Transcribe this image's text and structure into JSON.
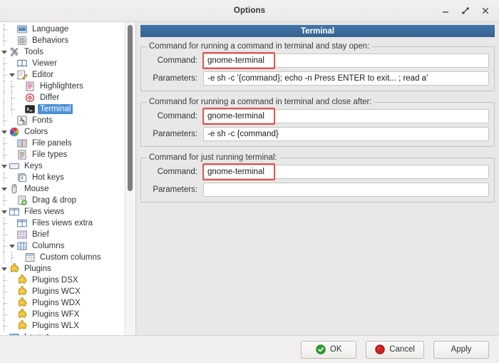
{
  "window": {
    "title": "Options",
    "minimize_label": "–",
    "maximize_label": "⤡",
    "close_label": "×"
  },
  "sidebar": {
    "items": [
      {
        "label": "Language",
        "level": 1,
        "icon": "language-icon",
        "expander": "none"
      },
      {
        "label": "Behaviors",
        "level": 1,
        "icon": "behaviors-icon",
        "expander": "none"
      },
      {
        "label": "Tools",
        "level": 0,
        "icon": "tools-icon",
        "expander": "down"
      },
      {
        "label": "Viewer",
        "level": 1,
        "icon": "viewer-icon",
        "expander": "none"
      },
      {
        "label": "Editor",
        "level": 1,
        "icon": "editor-icon",
        "expander": "down"
      },
      {
        "label": "Highlighters",
        "level": 2,
        "icon": "highlighters-icon",
        "expander": "none"
      },
      {
        "label": "Differ",
        "level": 2,
        "icon": "differ-icon",
        "expander": "none"
      },
      {
        "label": "Terminal",
        "level": 2,
        "icon": "terminal-icon",
        "expander": "none",
        "selected": true
      },
      {
        "label": "Fonts",
        "level": 1,
        "icon": "fonts-icon",
        "expander": "none"
      },
      {
        "label": "Colors",
        "level": 0,
        "icon": "colors-icon",
        "expander": "down"
      },
      {
        "label": "File panels",
        "level": 1,
        "icon": "file-panels-icon",
        "expander": "none"
      },
      {
        "label": "File types",
        "level": 1,
        "icon": "file-types-icon",
        "expander": "none"
      },
      {
        "label": "Keys",
        "level": 0,
        "icon": "keys-icon",
        "expander": "down"
      },
      {
        "label": "Hot keys",
        "level": 1,
        "icon": "hot-keys-icon",
        "expander": "none"
      },
      {
        "label": "Mouse",
        "level": 0,
        "icon": "mouse-icon",
        "expander": "down"
      },
      {
        "label": "Drag & drop",
        "level": 1,
        "icon": "drag-drop-icon",
        "expander": "none"
      },
      {
        "label": "Files views",
        "level": 0,
        "icon": "files-views-icon",
        "expander": "down"
      },
      {
        "label": "Files views extra",
        "level": 1,
        "icon": "files-views-extra-icon",
        "expander": "none"
      },
      {
        "label": "Brief",
        "level": 1,
        "icon": "brief-icon",
        "expander": "none"
      },
      {
        "label": "Columns",
        "level": 1,
        "icon": "columns-icon",
        "expander": "down"
      },
      {
        "label": "Custom columns",
        "level": 2,
        "icon": "custom-columns-icon",
        "expander": "none"
      },
      {
        "label": "Plugins",
        "level": 0,
        "icon": "plugins-icon",
        "expander": "down"
      },
      {
        "label": "Plugins DSX",
        "level": 1,
        "icon": "plugin-dsx-icon",
        "expander": "none"
      },
      {
        "label": "Plugins WCX",
        "level": 1,
        "icon": "plugin-wcx-icon",
        "expander": "none"
      },
      {
        "label": "Plugins WDX",
        "level": 1,
        "icon": "plugin-wdx-icon",
        "expander": "none"
      },
      {
        "label": "Plugins WFX",
        "level": 1,
        "icon": "plugin-wfx-icon",
        "expander": "none"
      },
      {
        "label": "Plugins WLX",
        "level": 1,
        "icon": "plugin-wlx-icon",
        "expander": "none"
      },
      {
        "label": "Layout",
        "level": 0,
        "icon": "layout-icon",
        "expander": "down"
      }
    ]
  },
  "main": {
    "header_title": "Terminal",
    "groups": [
      {
        "legend": "Command for running a command in terminal and stay open:",
        "command_label": "Command:",
        "command_value": "gnome-terminal",
        "command_highlighted": true,
        "parameters_label": "Parameters:",
        "parameters_value": "-e sh -c '{command}; echo -n Press ENTER to exit... ; read a'"
      },
      {
        "legend": "Command for running a command in terminal and close after:",
        "command_label": "Command:",
        "command_value": "gnome-terminal",
        "command_highlighted": true,
        "parameters_label": "Parameters:",
        "parameters_value": "-e sh -c {command}"
      },
      {
        "legend": "Command for just running terminal:",
        "command_label": "Command:",
        "command_value": "gnome-terminal",
        "command_highlighted": true,
        "parameters_label": "Parameters:",
        "parameters_value": ""
      }
    ]
  },
  "footer": {
    "ok_label": "OK",
    "cancel_label": "Cancel",
    "apply_label": "Apply"
  },
  "colors": {
    "header_blue": "#3a6ea5",
    "selection_blue": "#4a90d9",
    "annotation_red": "#e8524a",
    "ok_green": "#2aa02a",
    "cancel_red": "#cc2020",
    "panel_gray": "#e8e8e8"
  }
}
